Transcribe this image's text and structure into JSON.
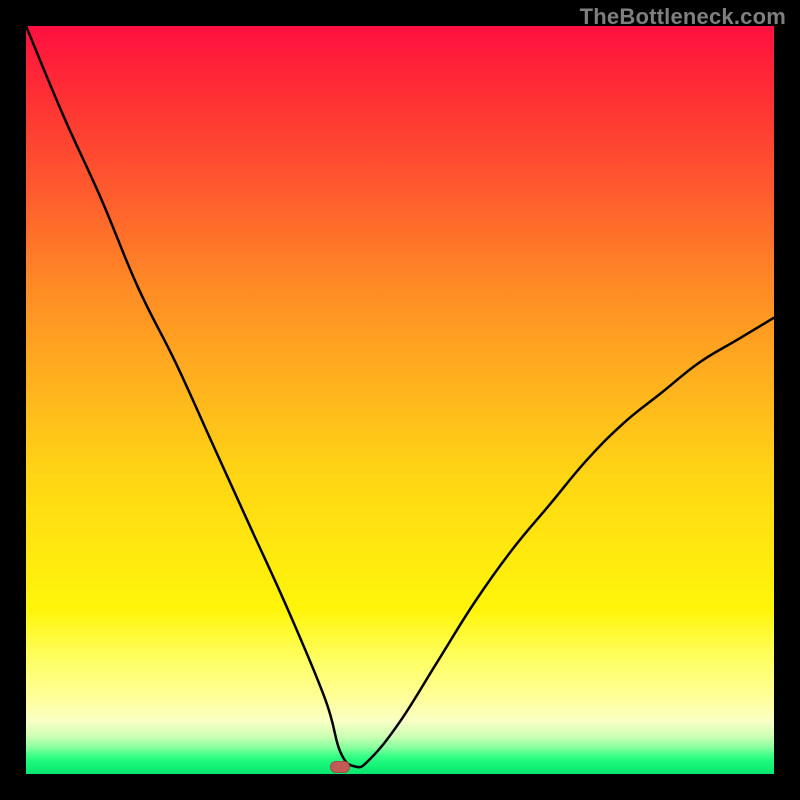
{
  "watermark": "TheBottleneck.com",
  "colors": {
    "frame": "#000000",
    "watermark_text": "#7f7f7f",
    "curve": "#000000",
    "marker": "#c45a56"
  },
  "chart_data": {
    "type": "line",
    "title": "",
    "xlabel": "",
    "ylabel": "",
    "xlim": [
      0,
      100
    ],
    "ylim": [
      0,
      100
    ],
    "x": [
      0,
      5,
      10,
      15,
      20,
      25,
      30,
      35,
      40,
      42,
      44,
      46,
      50,
      55,
      60,
      65,
      70,
      75,
      80,
      85,
      90,
      95,
      100
    ],
    "values": [
      100,
      88,
      77,
      65,
      55,
      44,
      33,
      22,
      10,
      3,
      1,
      2,
      7,
      15,
      23,
      30,
      36,
      42,
      47,
      51,
      55,
      58,
      61
    ],
    "series": [
      {
        "name": "bottleneck-curve",
        "values": [
          100,
          88,
          77,
          65,
          55,
          44,
          33,
          22,
          10,
          3,
          1,
          2,
          7,
          15,
          23,
          30,
          36,
          42,
          47,
          51,
          55,
          58,
          61
        ]
      }
    ],
    "marker": {
      "x": 42,
      "y": 1
    },
    "gradient_stops": [
      {
        "pos": 0,
        "color": "#ff1040"
      },
      {
        "pos": 0.35,
        "color": "#ff8b25"
      },
      {
        "pos": 0.7,
        "color": "#ffe80f"
      },
      {
        "pos": 0.93,
        "color": "#f8ffc4"
      },
      {
        "pos": 1.0,
        "color": "#08e66e"
      }
    ]
  }
}
